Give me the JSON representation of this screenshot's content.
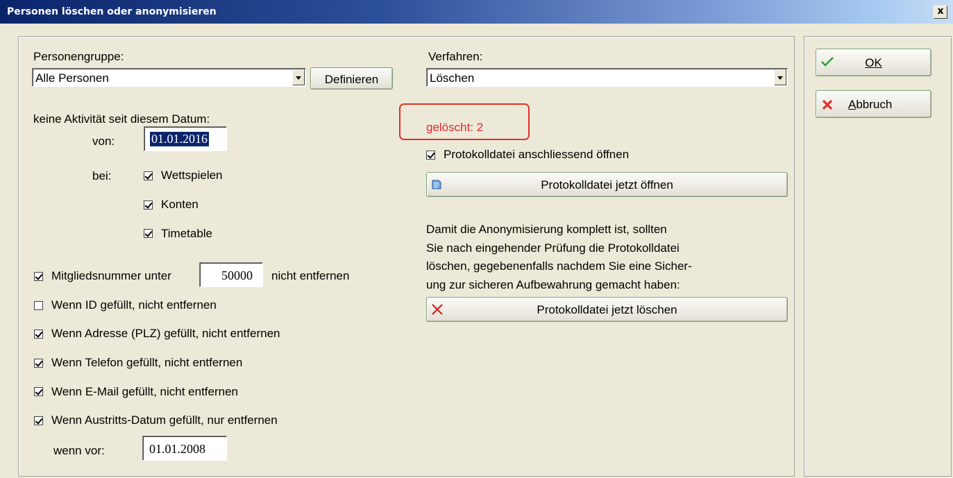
{
  "window": {
    "title": "Personen löschen oder anonymisieren",
    "close_label": "x"
  },
  "group": {
    "label": "Personengruppe:",
    "selected": "Alle Personen",
    "define_button": "Definieren"
  },
  "method": {
    "label": "Verfahren:",
    "selected": "Löschen"
  },
  "inactivity": {
    "heading": "keine Aktivität seit diesem Datum:",
    "from_label": "von:",
    "from_value": "01.01.2016",
    "at_label": "bei:",
    "options": [
      {
        "label": "Wettspielen",
        "checked": true
      },
      {
        "label": "Konten",
        "checked": true
      },
      {
        "label": "Timetable",
        "checked": true
      }
    ]
  },
  "member_number": {
    "checked": true,
    "prefix": "Mitgliedsnummer unter",
    "value": "50000",
    "suffix": "nicht entfernen"
  },
  "conditions": [
    {
      "label": "Wenn ID gefüllt, nicht entfernen",
      "checked": false
    },
    {
      "label": "Wenn Adresse (PLZ) gefüllt, nicht entfernen",
      "checked": true
    },
    {
      "label": "Wenn Telefon gefüllt, nicht entfernen",
      "checked": true
    },
    {
      "label": "Wenn E-Mail gefüllt, nicht entfernen",
      "checked": true
    },
    {
      "label": "Wenn Austritts-Datum gefüllt, nur entfernen",
      "checked": true
    }
  ],
  "exit_date": {
    "label": "wenn vor:",
    "value": "01.01.2008"
  },
  "status": {
    "deleted_text": "gelöscht: 2",
    "color": "#e8272c"
  },
  "protocol": {
    "open_after_label": "Protokolldatei anschliessend öffnen",
    "open_after_checked": true,
    "open_now_button": "Protokolldatei jetzt öffnen",
    "note_lines": [
      "Damit die Anonymisierung komplett ist, sollten",
      "Sie nach eingehender Prüfung die Protokolldatei",
      "löschen, gegebenenfalls nachdem Sie eine Sicher-",
      "ung zur sicheren Aufbewahrung gemacht haben:"
    ],
    "delete_now_button": "Protokolldatei jetzt löschen"
  },
  "actions": {
    "ok_label": "OK",
    "cancel_label": "Abbruch"
  },
  "icons": {
    "ok": "checkmark-icon",
    "cancel": "cross-icon",
    "open_file": "document-icon",
    "delete_file": "cross-icon"
  }
}
